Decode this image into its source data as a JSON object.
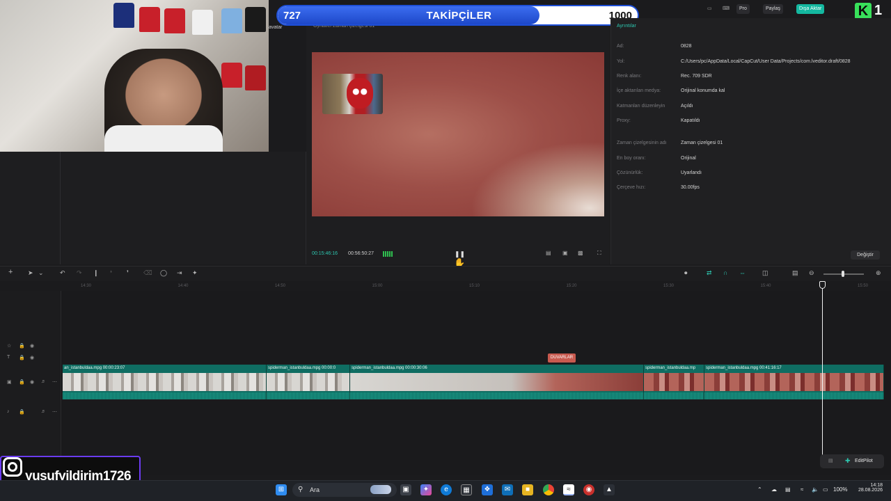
{
  "overlay": {
    "followers": {
      "current": "727",
      "title": "TAKİPÇİLER",
      "goal": "1000",
      "progress": 0.727
    },
    "kick_count": "1",
    "kick_letter": "K",
    "instagram_handle": "yusufyildirim1726"
  },
  "topbar": {
    "pro_label": "Pro",
    "share_label": "Paylaş",
    "export_label": "Dışa Aktar"
  },
  "left_panel": {
    "tab_label": "avatar"
  },
  "player": {
    "title": "Oynatıcı Zaman çizelgesi 01",
    "current_time": "00:15:46:16",
    "total_time": "00:56:50:27"
  },
  "properties": {
    "tab_label": "Ayrıntılar",
    "rows": [
      {
        "label": "Ad:",
        "value": "0828"
      },
      {
        "label": "Yol:",
        "value": "C:/Users/pc/AppData/Local/CapCut/User Data/Projects/com.lveditor.draft/0828"
      },
      {
        "label": "Renk alanı:",
        "value": "Rec. 709 SDR"
      },
      {
        "label": "İçe aktarılan medya:",
        "value": "Orijinal konumda kal"
      },
      {
        "label": "Katmanları düzenleyin",
        "value": "Açıldı"
      },
      {
        "label": "Proxy:",
        "value": "Kapatıldı"
      },
      {
        "label": "Zaman çizelgesinin adı",
        "value": "Zaman çizelgesi 01"
      },
      {
        "label": "En boy oranı:",
        "value": "Orijinal"
      },
      {
        "label": "Çözünürlük:",
        "value": "Uyarlandı"
      },
      {
        "label": "Çerçeve hızı:",
        "value": "30.00fps"
      }
    ],
    "change_button": "Değiştir"
  },
  "timeline": {
    "ruler_ticks": [
      "14:30",
      "14:40",
      "14:50",
      "15:00",
      "15:10",
      "15:20",
      "15:30",
      "15:40",
      "15:50"
    ],
    "text_clip": "DUVARLAR",
    "clips": [
      {
        "label": "an_istanbuldaa.mpg  00:00:23:07",
        "style": "street"
      },
      {
        "label": "spiderman_istanbuldaa.mpg  00:00:0",
        "style": "street"
      },
      {
        "label": "spiderman_istanbuldaa.mpg  00:00:30:06",
        "style": "mix"
      },
      {
        "label": "spiderman_istanbuldaa.mp",
        "style": "red"
      },
      {
        "label": "spiderman_istanbuldaa.mpg  00:41:16:17",
        "style": "red"
      }
    ],
    "editpilot_label": "EditPilot"
  },
  "taskbar": {
    "search_label": "Ara",
    "battery": "100%",
    "time": "14:18",
    "date": "28.08.2026"
  },
  "colors": {
    "accent": "#2dc7b0",
    "follower_bar": "#1e4fd8",
    "clip": "#0f6d62",
    "text_clip": "#c85a4f",
    "kick_green": "#38e05a"
  }
}
